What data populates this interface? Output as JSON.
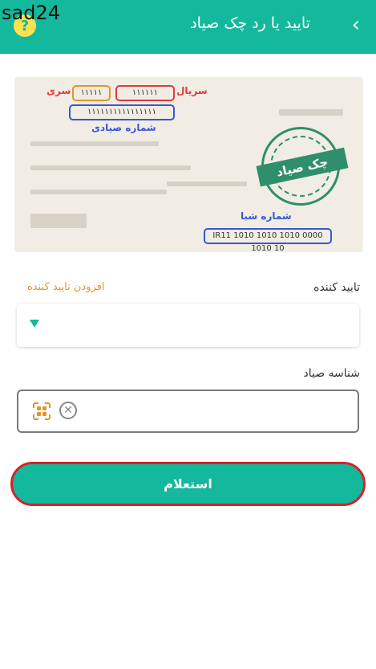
{
  "watermark": "sad24",
  "header": {
    "title": "تایید یا رد چک صیاد",
    "help_glyph": "?",
    "back_glyph": "‹"
  },
  "check_card": {
    "serial_label": "سریال",
    "series_label": "سری",
    "serial_value": "۱۱۱۱۱۱",
    "series_value": "۱۱۱۱۱",
    "sayadi_value": "۱۱۱۱۱۱۱۱۱۱۱۱۱۱۱۱",
    "sayadi_label": "شماره صیادی",
    "seal_text": "چک صیاد",
    "shaba_label": "شماره شبا",
    "shaba_value": "IR11 1010 1010 1010 0000 1010 10"
  },
  "form": {
    "confirmer_label": "تایید کننده",
    "add_confirmer_link": "افزودن تایید کننده",
    "sayad_id_label": "شناسه صیاد"
  },
  "submit_label": "استعلام",
  "colors": {
    "primary": "#14b89c",
    "accent": "#e0962a",
    "highlight_border": "#d3232a"
  }
}
